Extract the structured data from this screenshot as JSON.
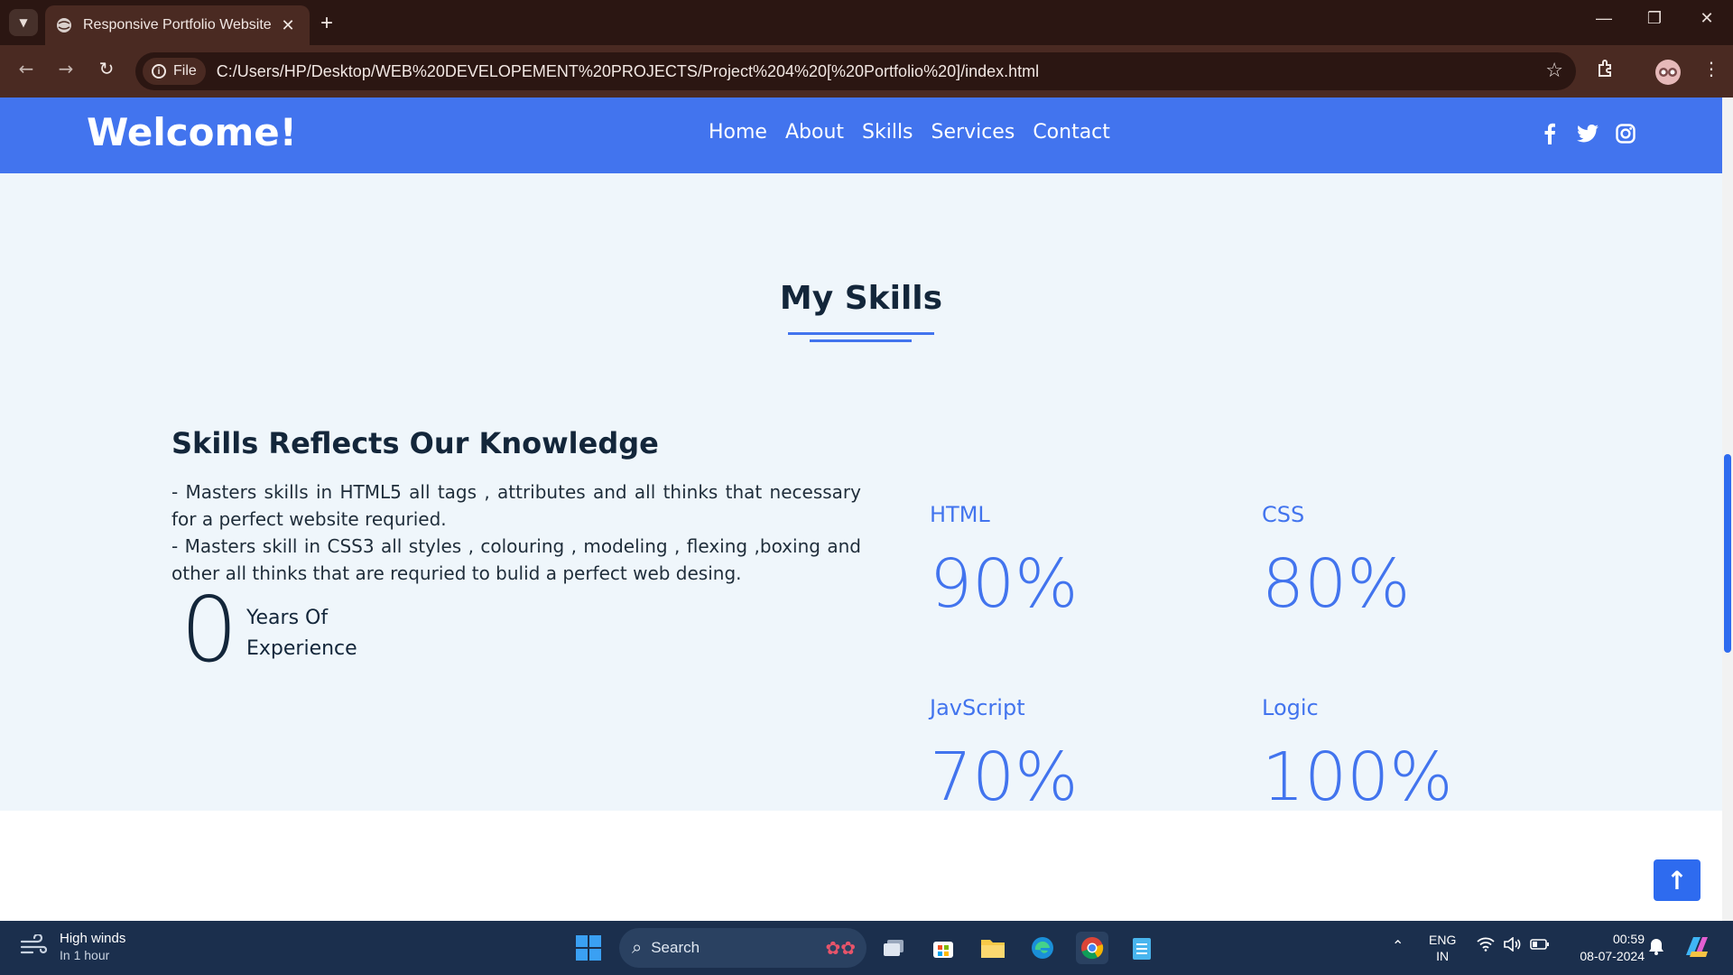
{
  "browser": {
    "tab_title": "Responsive Portfolio Website H",
    "url_chip": "File",
    "url": "C:/Users/HP/Desktop/WEB%20DEVELOPEMENT%20PROJECTS/Project%204%20[%20Portfolio%20]/index.html"
  },
  "header": {
    "logo": "Welcome!",
    "nav": [
      "Home",
      "About",
      "Skills",
      "Services",
      "Contact"
    ],
    "socials": [
      "facebook-icon",
      "twitter-icon",
      "instagram-icon"
    ]
  },
  "skills": {
    "title": "My Skills",
    "heading": "Skills Reflects Our Knowledge",
    "desc_line1": "- Masters skills in HTML5 all tags , attributes and all thinks that necessary for a perfect website requried.",
    "desc_line2": "- Masters skill in CSS3 all styles , colouring , modeling , flexing ,boxing and other all thinks that are requried to bulid a perfect web desing.",
    "years_value": "0",
    "years_label_1": "Years Of",
    "years_label_2": "Experience",
    "cards": [
      {
        "name": "HTML",
        "percent": "90%"
      },
      {
        "name": "CSS",
        "percent": "80%"
      },
      {
        "name": "JavScript",
        "percent": "70%"
      },
      {
        "name": "Logic",
        "percent": "100%"
      }
    ]
  },
  "colors": {
    "accent": "#4274ee",
    "section_bg": "#eff6fb",
    "text_dark": "#13263a"
  },
  "taskbar": {
    "weather_title": "High winds",
    "weather_sub": "In 1 hour",
    "search_placeholder": "Search",
    "lang_1": "ENG",
    "lang_2": "IN",
    "time": "00:59",
    "date": "08-07-2024"
  }
}
